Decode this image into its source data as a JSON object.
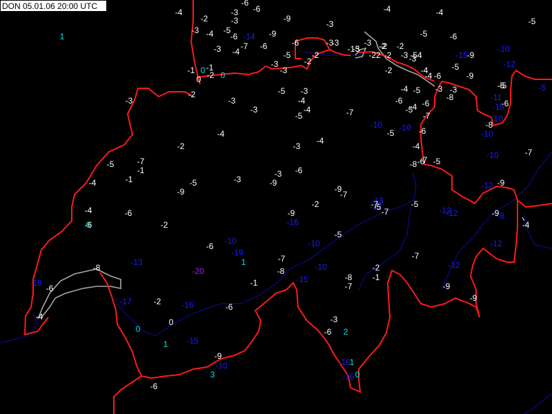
{
  "header": {
    "title": "DON 05.01.06 20:00 UTC"
  },
  "colors": {
    "white": "#ffffff",
    "cyan": "#00e5e5",
    "blue": "#1a1aff",
    "purple": "#9a22ee",
    "border": "#ff1a1a",
    "river": "#0a0a8c",
    "lake": "#a8a8a8",
    "background": "#000000"
  },
  "values": [
    {
      "t": "-4",
      "c": "white"
    },
    {
      "t": "-2",
      "c": "white"
    },
    {
      "t": "-3",
      "c": "white"
    },
    {
      "t": "-6",
      "c": "white"
    },
    {
      "t": "-3",
      "c": "white"
    },
    {
      "t": "-6",
      "c": "white"
    },
    {
      "t": "-9",
      "c": "white"
    },
    {
      "t": "-3",
      "c": "white"
    },
    {
      "t": "-4",
      "c": "white"
    },
    {
      "t": "-4",
      "c": "white"
    },
    {
      "t": "-5",
      "c": "white"
    },
    {
      "t": "1",
      "c": "cyan"
    },
    {
      "t": "-3",
      "c": "white"
    },
    {
      "t": "-4",
      "c": "white"
    },
    {
      "t": "-5",
      "c": "white"
    },
    {
      "t": "-6",
      "c": "white"
    },
    {
      "t": "-14",
      "c": "blue"
    },
    {
      "t": "-9",
      "c": "white"
    },
    {
      "t": "-3",
      "c": "white"
    },
    {
      "t": "-6",
      "c": "white"
    },
    {
      "t": "-3",
      "c": "white"
    },
    {
      "t": "-4",
      "c": "white"
    },
    {
      "t": "-7",
      "c": "white"
    },
    {
      "t": "-6",
      "c": "white"
    },
    {
      "t": "-5",
      "c": "white"
    },
    {
      "t": "-3",
      "c": "white"
    },
    {
      "t": "-2",
      "c": "white"
    },
    {
      "t": "-5",
      "c": "white"
    },
    {
      "t": "-2",
      "c": "white"
    },
    {
      "t": "-2",
      "c": "white"
    },
    {
      "t": "-1",
      "c": "white"
    },
    {
      "t": "3",
      "c": "white"
    },
    {
      "t": "-3",
      "c": "white"
    },
    {
      "t": "-22",
      "c": "white"
    },
    {
      "t": "-2",
      "c": "white"
    },
    {
      "t": "-3",
      "c": "white"
    },
    {
      "t": "-54",
      "c": "white"
    },
    {
      "t": "-15",
      "c": "blue"
    },
    {
      "t": "-9",
      "c": "white"
    },
    {
      "t": "-10",
      "c": "blue"
    },
    {
      "t": "-2",
      "c": "white"
    },
    {
      "t": "-2",
      "c": "white"
    },
    {
      "t": "-3",
      "c": "white"
    },
    {
      "t": "-5",
      "c": "white"
    },
    {
      "t": "-6",
      "c": "white"
    },
    {
      "t": "-12",
      "c": "blue"
    },
    {
      "t": "-1",
      "c": "white"
    },
    {
      "t": "0",
      "c": "cyan"
    },
    {
      "t": "-1",
      "c": "white"
    },
    {
      "t": "-2",
      "c": "white"
    },
    {
      "t": "0",
      "c": "white"
    },
    {
      "t": "0",
      "c": "cyan"
    },
    {
      "t": "-3",
      "c": "white"
    },
    {
      "t": "-3",
      "c": "white"
    },
    {
      "t": "-2",
      "c": "white"
    },
    {
      "t": "-4",
      "c": "white"
    },
    {
      "t": "-4",
      "c": "white"
    },
    {
      "t": "-6",
      "c": "white"
    },
    {
      "t": "-9",
      "c": "white"
    },
    {
      "t": "-5",
      "c": "white"
    },
    {
      "t": "-3",
      "c": "white"
    },
    {
      "t": "-4",
      "c": "white"
    },
    {
      "t": "-5",
      "c": "white"
    },
    {
      "t": "-5",
      "c": "white"
    },
    {
      "t": "-3",
      "c": "white"
    },
    {
      "t": "-5",
      "c": "white"
    },
    {
      "t": "-5",
      "c": "blue"
    },
    {
      "t": "-11",
      "c": "blue"
    },
    {
      "t": "-2",
      "c": "white"
    },
    {
      "t": "-8",
      "c": "white"
    },
    {
      "t": "-3",
      "c": "white"
    },
    {
      "t": "-3",
      "c": "white"
    },
    {
      "t": "-3",
      "c": "white"
    },
    {
      "t": "-5",
      "c": "white"
    },
    {
      "t": "-4",
      "c": "white"
    },
    {
      "t": "-6",
      "c": "white"
    },
    {
      "t": "-6",
      "c": "white"
    },
    {
      "t": "-15",
      "c": "blue"
    },
    {
      "t": "-6",
      "c": "white"
    },
    {
      "t": "-3",
      "c": "white"
    },
    {
      "t": "-4",
      "c": "white"
    },
    {
      "t": "-5",
      "c": "white"
    },
    {
      "t": "-7",
      "c": "white"
    },
    {
      "t": "-5",
      "c": "white"
    },
    {
      "t": "-4",
      "c": "white"
    },
    {
      "t": "-7",
      "c": "white"
    },
    {
      "t": "-10",
      "c": "blue"
    },
    {
      "t": "-10",
      "c": "blue"
    },
    {
      "t": "-5",
      "c": "white"
    },
    {
      "t": "-10",
      "c": "blue"
    },
    {
      "t": "-6",
      "c": "white"
    },
    {
      "t": "-8",
      "c": "white"
    },
    {
      "t": "-10",
      "c": "blue"
    },
    {
      "t": "-4",
      "c": "white"
    },
    {
      "t": "-4",
      "c": "white"
    },
    {
      "t": "-2",
      "c": "white"
    },
    {
      "t": "-3",
      "c": "white"
    },
    {
      "t": "-4",
      "c": "white"
    },
    {
      "t": "-7",
      "c": "white"
    },
    {
      "t": "-7",
      "c": "white"
    },
    {
      "t": "-1",
      "c": "white"
    },
    {
      "t": "-5",
      "c": "white"
    },
    {
      "t": "-6",
      "c": "white"
    },
    {
      "t": "-3",
      "c": "white"
    },
    {
      "t": "-6",
      "c": "white"
    },
    {
      "t": "-9",
      "c": "white"
    },
    {
      "t": "-8",
      "c": "white"
    },
    {
      "t": "-5",
      "c": "white"
    },
    {
      "t": "-7",
      "c": "white"
    },
    {
      "t": "-10",
      "c": "blue"
    },
    {
      "t": "-1",
      "c": "white"
    },
    {
      "t": "-4",
      "c": "white"
    },
    {
      "t": "-5",
      "c": "white"
    },
    {
      "t": "-3",
      "c": "white"
    },
    {
      "t": "-9",
      "c": "white"
    },
    {
      "t": "-9",
      "c": "white"
    },
    {
      "t": "-7",
      "c": "white"
    },
    {
      "t": "-12",
      "c": "blue"
    },
    {
      "t": "-9",
      "c": "white"
    },
    {
      "t": "-4",
      "c": "white"
    },
    {
      "t": "-6",
      "c": "white"
    },
    {
      "t": "-2",
      "c": "white"
    },
    {
      "t": "-9",
      "c": "white"
    },
    {
      "t": "-13",
      "c": "blue"
    },
    {
      "t": "-12",
      "c": "blue"
    },
    {
      "t": "-7",
      "c": "white"
    },
    {
      "t": "-5",
      "c": "white"
    },
    {
      "t": "-12",
      "c": "blue"
    },
    {
      "t": "-12",
      "c": "blue"
    },
    {
      "t": "-9",
      "c": "white"
    },
    {
      "t": "-8",
      "c": "blue"
    },
    {
      "t": "-6",
      "c": "white"
    },
    {
      "t": "-2",
      "c": "white"
    },
    {
      "t": "-16",
      "c": "blue"
    },
    {
      "t": "0",
      "c": "cyan"
    },
    {
      "t": "-5",
      "c": "white"
    },
    {
      "t": "-10",
      "c": "blue"
    },
    {
      "t": "-4",
      "c": "white"
    },
    {
      "t": "-10",
      "c": "blue"
    },
    {
      "t": "-12",
      "c": "blue"
    },
    {
      "t": "-6",
      "c": "white"
    },
    {
      "t": "-19",
      "c": "blue"
    },
    {
      "t": "-7",
      "c": "white"
    },
    {
      "t": "-7",
      "c": "white"
    },
    {
      "t": "-13",
      "c": "blue"
    },
    {
      "t": "-8",
      "c": "white"
    },
    {
      "t": "1",
      "c": "cyan"
    },
    {
      "t": "-20",
      "c": "purple"
    },
    {
      "t": "-7",
      "c": "white"
    },
    {
      "t": "-8",
      "c": "white"
    },
    {
      "t": "-10",
      "c": "blue"
    },
    {
      "t": "-2",
      "c": "white"
    },
    {
      "t": "-5",
      "c": "white"
    },
    {
      "t": "-12",
      "c": "blue"
    },
    {
      "t": "-18",
      "c": "blue"
    },
    {
      "t": "-6",
      "c": "white"
    },
    {
      "t": "-1",
      "c": "white"
    },
    {
      "t": "-15",
      "c": "blue"
    },
    {
      "t": "-8",
      "c": "white"
    },
    {
      "t": "-1",
      "c": "white"
    },
    {
      "t": "-7",
      "c": "white"
    },
    {
      "t": "-9",
      "c": "white"
    },
    {
      "t": "-17",
      "c": "blue"
    },
    {
      "t": "-2",
      "c": "white"
    },
    {
      "t": "-16",
      "c": "blue"
    },
    {
      "t": "-6",
      "c": "white"
    },
    {
      "t": "-9",
      "c": "white"
    },
    {
      "t": "-4",
      "c": "white"
    },
    {
      "t": "0",
      "c": "cyan"
    },
    {
      "t": "0",
      "c": "white"
    },
    {
      "t": "-3",
      "c": "white"
    },
    {
      "t": "-6",
      "c": "white"
    },
    {
      "t": "2",
      "c": "cyan"
    },
    {
      "t": "1",
      "c": "cyan"
    },
    {
      "t": "-15",
      "c": "blue"
    },
    {
      "t": "-9",
      "c": "white"
    },
    {
      "t": "-10",
      "c": "blue"
    },
    {
      "t": "-16",
      "c": "blue"
    },
    {
      "t": "1",
      "c": "cyan"
    },
    {
      "t": "3",
      "c": "cyan"
    },
    {
      "t": "-16",
      "c": "blue"
    },
    {
      "t": "0",
      "c": "cyan"
    },
    {
      "t": "-6",
      "c": "white"
    },
    {
      "t": "-13",
      "c": "blue"
    }
  ]
}
